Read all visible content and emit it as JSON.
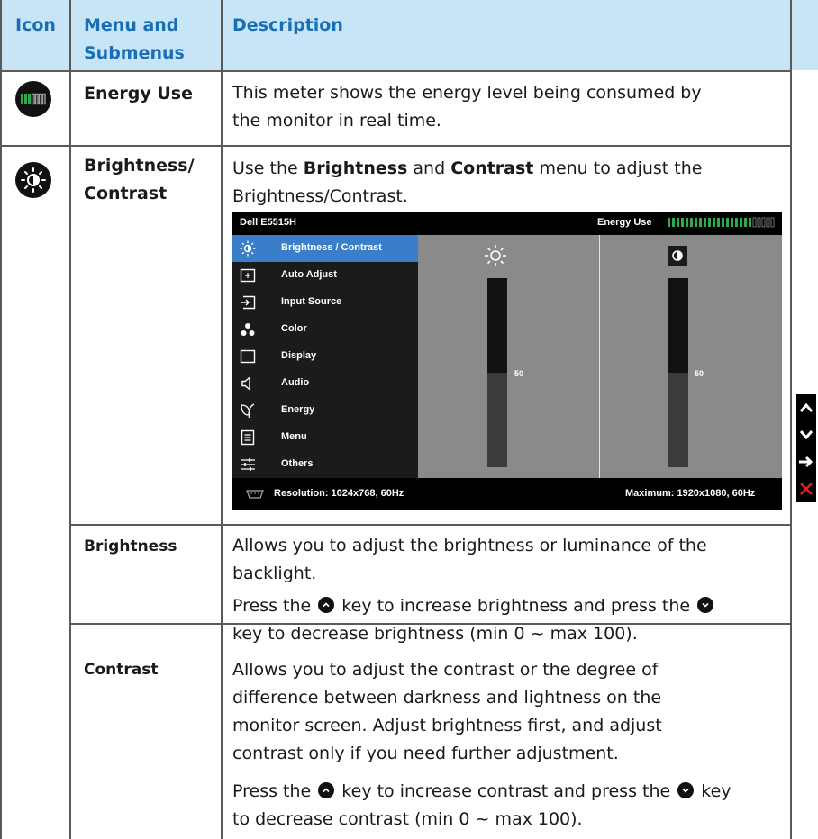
{
  "header": {
    "icon": "Icon",
    "menu": "Menu and Submenus",
    "menu_line1": "Menu and",
    "menu_line2": "Submenus",
    "description": "Description"
  },
  "rows": {
    "energy": {
      "menu": "Energy Use",
      "desc_line1": "This meter shows the energy level being consumed by",
      "desc_line2": "the monitor in real time."
    },
    "brightness_contrast": {
      "menu_line1": "Brightness/",
      "menu_line2": "Contrast",
      "desc_pre": "Use the ",
      "desc_b1": "Brightness",
      "desc_mid": " and ",
      "desc_b2": "Contrast",
      "desc_post": " menu to adjust the",
      "desc_line2": "Brightness/Contrast."
    },
    "brightness": {
      "menu": "Brightness",
      "p1_line1": "Allows you to adjust the brightness or luminance of the",
      "p1_line2": "backlight.",
      "p2_pre": "Press the ",
      "p2_mid": " key to increase brightness and press the ",
      "p2_line2": "key to decrease brightness (min 0 ~ max 100)."
    },
    "contrast": {
      "menu": "Contrast",
      "p1_line1": "Allows you to adjust the contrast or the degree of",
      "p1_line2": "difference between darkness and lightness on the",
      "p1_line3": "monitor screen. Adjust brightness first, and adjust",
      "p1_line4": "contrast only if you need further adjustment.",
      "p2_pre": "Press the ",
      "p2_mid": " key to increase contrast and press the ",
      "p2_post": " key",
      "p2_line2": "to decrease contrast (min 0 ~ max 100)."
    }
  },
  "osd": {
    "model": "Dell E5515H",
    "energy_label": "Energy Use",
    "energy_level": 0.8,
    "menu_items": [
      {
        "label": "Brightness / Contrast",
        "icon": "brightness-icon",
        "selected": true
      },
      {
        "label": "Auto Adjust",
        "icon": "auto-adjust-icon",
        "selected": false
      },
      {
        "label": "Input Source",
        "icon": "input-source-icon",
        "selected": false
      },
      {
        "label": "Color",
        "icon": "color-icon",
        "selected": false
      },
      {
        "label": "Display",
        "icon": "display-icon",
        "selected": false
      },
      {
        "label": "Audio",
        "icon": "audio-icon",
        "selected": false
      },
      {
        "label": "Energy",
        "icon": "energy-leaf-icon",
        "selected": false
      },
      {
        "label": "Menu",
        "icon": "menu-icon",
        "selected": false
      },
      {
        "label": "Others",
        "icon": "others-icon",
        "selected": false
      }
    ],
    "brightness_value": "50",
    "contrast_value": "50",
    "brightness_level": 0.5,
    "contrast_level": 0.5,
    "resolution": "Resolution: 1024x768, 60Hz",
    "maximum": "Maximum: 1920x1080, 60Hz"
  },
  "nav_buttons": [
    "up-icon",
    "down-icon",
    "enter-icon",
    "exit-icon"
  ],
  "colors": {
    "header_bg": "#c8e4f7",
    "header_text": "#1a6fb4",
    "osd_selected": "#3a7dc9",
    "energy_green": "#2fa84f",
    "exit_red": "#e02020"
  }
}
